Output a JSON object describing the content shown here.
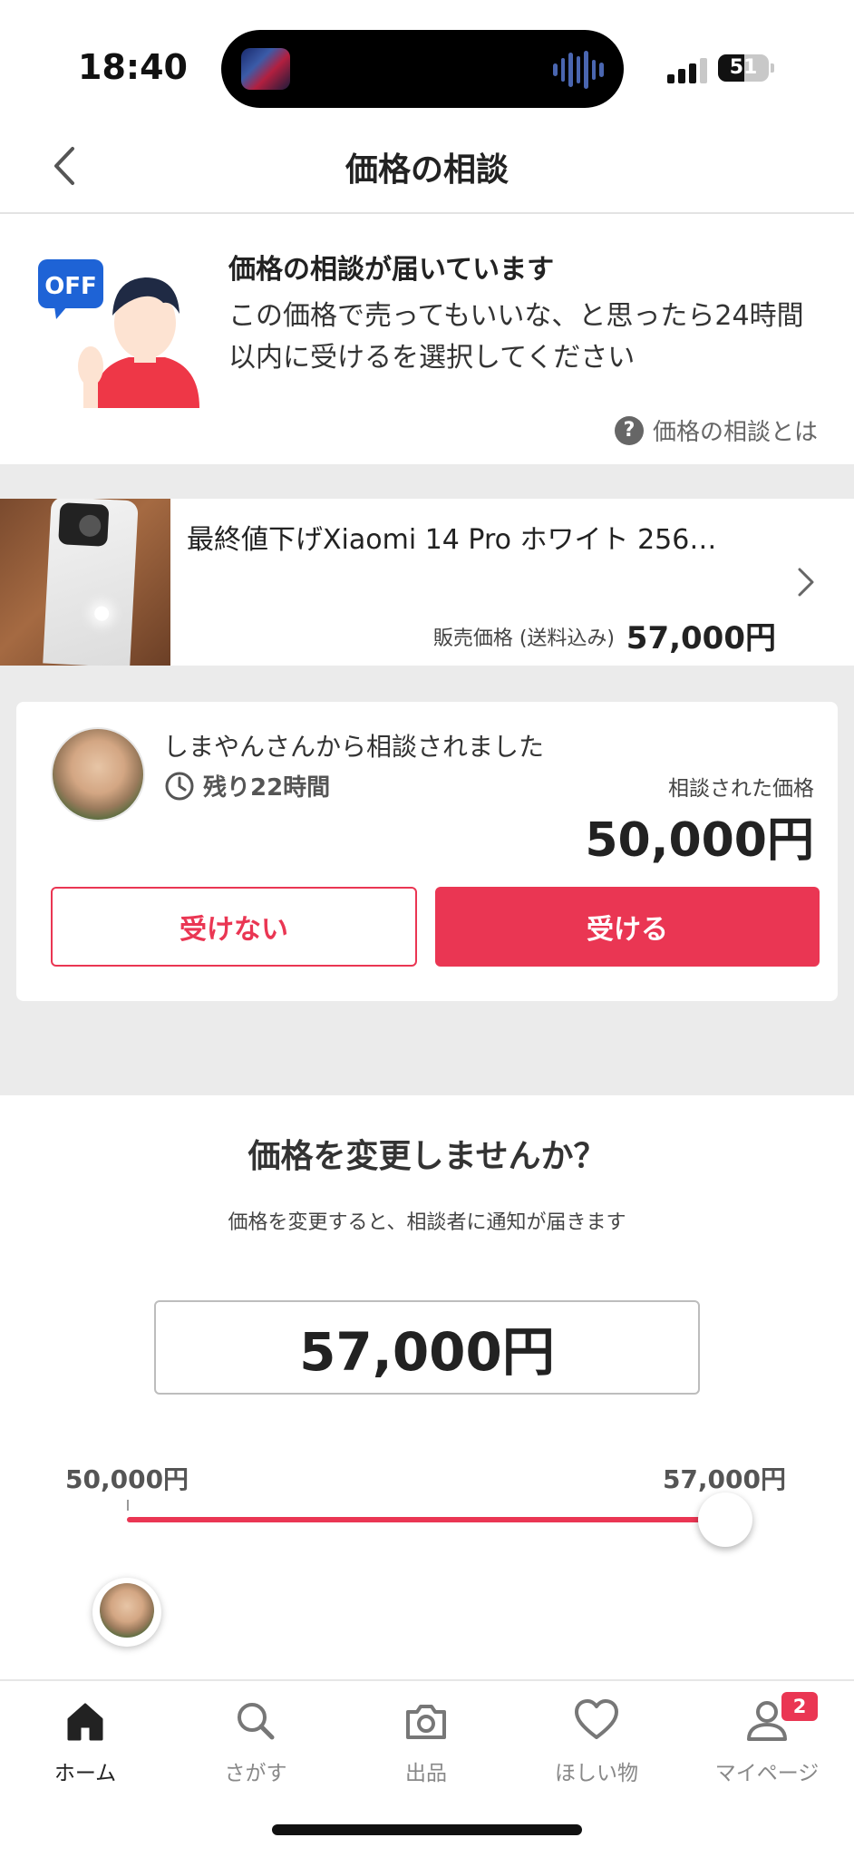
{
  "status_bar": {
    "time": "18:40",
    "battery": "51"
  },
  "nav": {
    "title": "価格の相談"
  },
  "notice": {
    "title": "価格の相談が届いています",
    "body": "この価格で売ってもいいな、と思ったら24時間以内に受けるを選択してください",
    "help_label": "価格の相談とは",
    "badge_text": "OFF"
  },
  "product": {
    "title": "最終値下げXiaomi 14 Pro ホワイト 256…",
    "price_label": "販売価格 (送料込み)",
    "price": "57,000円"
  },
  "offer": {
    "from_text": "しまやんさんから相談されました",
    "remaining": "残り22時間",
    "price_label": "相談された価格",
    "price": "50,000円",
    "decline_label": "受けない",
    "accept_label": "受ける"
  },
  "change_price": {
    "title": "価格を変更しませんか？",
    "subtitle": "価格を変更すると、相談者に通知が届きます",
    "value": "57,000円",
    "min_label": "50,000円",
    "max_label": "57,000円",
    "slider_fraction": 1.0
  },
  "tabs": [
    {
      "label": "ホーム",
      "icon": "home-icon",
      "active": true
    },
    {
      "label": "さがす",
      "icon": "search-icon",
      "active": false
    },
    {
      "label": "出品",
      "icon": "camera-icon",
      "active": false
    },
    {
      "label": "ほしい物",
      "icon": "heart-icon",
      "active": false
    },
    {
      "label": "マイページ",
      "icon": "person-icon",
      "active": false,
      "badge": "2"
    }
  ],
  "colors": {
    "accent": "#ea3653",
    "gray_bg": "#ebebeb"
  }
}
